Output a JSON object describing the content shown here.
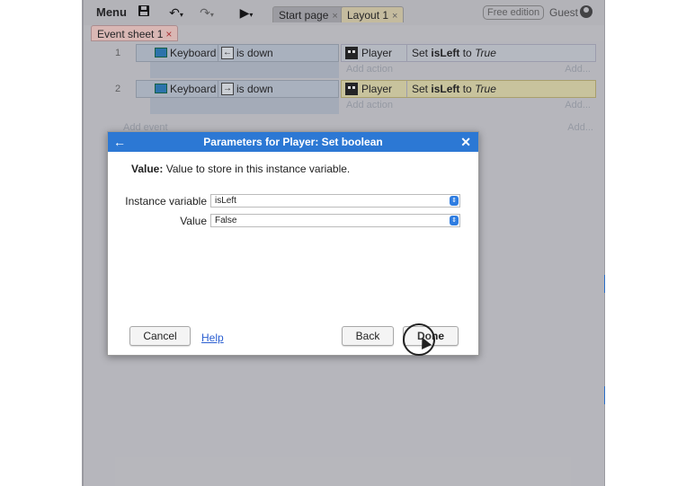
{
  "toolbar": {
    "menu_label": "Menu",
    "tabs": [
      {
        "label": "Start page",
        "close": "×"
      },
      {
        "label": "Layout 1",
        "close": "×"
      }
    ],
    "edition_badge": "Free edition",
    "user": "Guest"
  },
  "event_sheet_tab": {
    "label": "Event sheet 1",
    "close": "×"
  },
  "events": [
    {
      "number": "1",
      "object": "Keyboard",
      "key": "←",
      "condition": "is down",
      "action_object": "Player",
      "action_prefix": "Set",
      "action_var": "isLeft",
      "action_mid": "to",
      "action_value": "True",
      "add_action": "Add action",
      "add_right": "Add..."
    },
    {
      "number": "2",
      "object": "Keyboard",
      "key": "→",
      "condition": "is down",
      "action_object": "Player",
      "action_prefix": "Set",
      "action_var": "isLeft",
      "action_mid": "to",
      "action_value": "True",
      "add_action": "Add action",
      "add_right": "Add..."
    }
  ],
  "add_event": "Add event",
  "add_event_right": "Add...",
  "dialog": {
    "title": "Parameters for Player: Set boolean",
    "description_label": "Value:",
    "description_text": "Value to store in this instance variable.",
    "fields": [
      {
        "label": "Instance variable",
        "value": "isLeft"
      },
      {
        "label": "Value",
        "value": "False"
      }
    ],
    "cancel_label": "Cancel",
    "help_label": "Help",
    "back_label": "Back",
    "done_label": "Done"
  },
  "icons": {
    "back": "arrow-left-icon",
    "close": "close-icon",
    "save": "save-icon",
    "undo": "undo-icon",
    "redo": "redo-icon",
    "play": "play-icon"
  },
  "colors": {
    "dialog_title": "#2c78d4",
    "highlight_row": "#dcd6a9",
    "select_arrows": "#2f7de1"
  }
}
